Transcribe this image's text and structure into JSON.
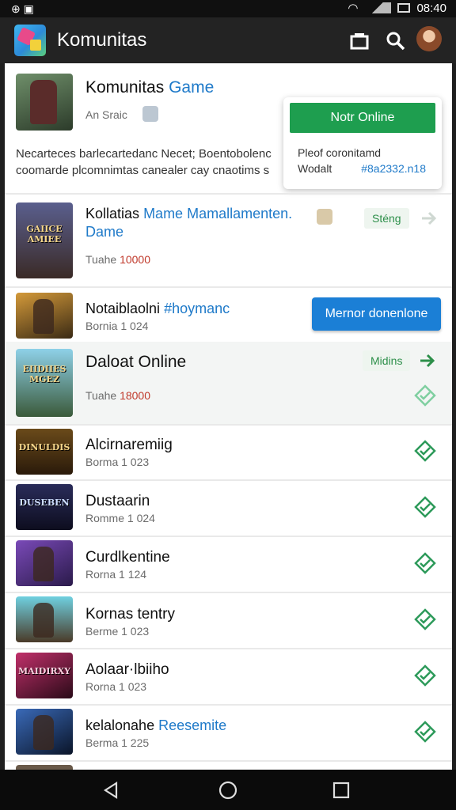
{
  "status": {
    "time": "08:40"
  },
  "appbar": {
    "title": "Komunitas",
    "icons": [
      "app-logo-icon",
      "folder-icon",
      "search-icon",
      "profile-avatar"
    ]
  },
  "featured": {
    "title_plain": "Komunitas",
    "title_accent": "Game",
    "subtitle": "An Sraic",
    "description": "Necarteces barlecartedanc Necet; Boentobolenc coomarde plcomnimtas canealer cay cnaotims s",
    "popover": {
      "button": "Notr Online",
      "line1": "Pleof coronitamd",
      "line2_label": "Wodalt",
      "line2_value": "#8a2332.n18"
    }
  },
  "rows": [
    {
      "title": "Kollatias",
      "title_accent": "Mame Mamallamenten.",
      "title_line2": "Dame",
      "subtitle_label": "Tuahe",
      "subtitle_value": "10000",
      "thumb_text": "GAIICE\nAMIEE",
      "action": "Sténg"
    },
    {
      "title": "Notaiblaolni",
      "title_accent": "#hoymanc",
      "subtitle": "Bornia 1 024",
      "thumb_text": "",
      "action": "Mernor donenlone"
    },
    {
      "title": "Daloat Online",
      "subtitle_label": "Tuahe",
      "subtitle_value": "18000",
      "thumb_text": "EIIDIIES\nMGEZ",
      "action": "Midins"
    },
    {
      "title": "Alcirnaremiig",
      "subtitle": "Borma 1 023",
      "thumb_text": "DINULDIS"
    },
    {
      "title": "Dustaarin",
      "subtitle": "Romme 1 024",
      "thumb_text": "DUSEBEN"
    },
    {
      "title": "Curdlkentine",
      "subtitle": "Rorna 1 124",
      "thumb_text": ""
    },
    {
      "title": "Kornas tentry",
      "subtitle": "Berme 1 023",
      "thumb_text": ""
    },
    {
      "title": "Aolaar·lbiiho",
      "subtitle": "Rorna 1 023",
      "thumb_text": "MAIDIRXY"
    },
    {
      "title": "kelalonahe",
      "title_accent": "Reesemite",
      "subtitle": "Berma 1 225",
      "thumb_text": ""
    }
  ],
  "colors": {
    "accent_blue": "#1f7ac9",
    "green": "#1e9e4f",
    "blue_button": "#1b7fd6",
    "red": "#c0392b"
  }
}
